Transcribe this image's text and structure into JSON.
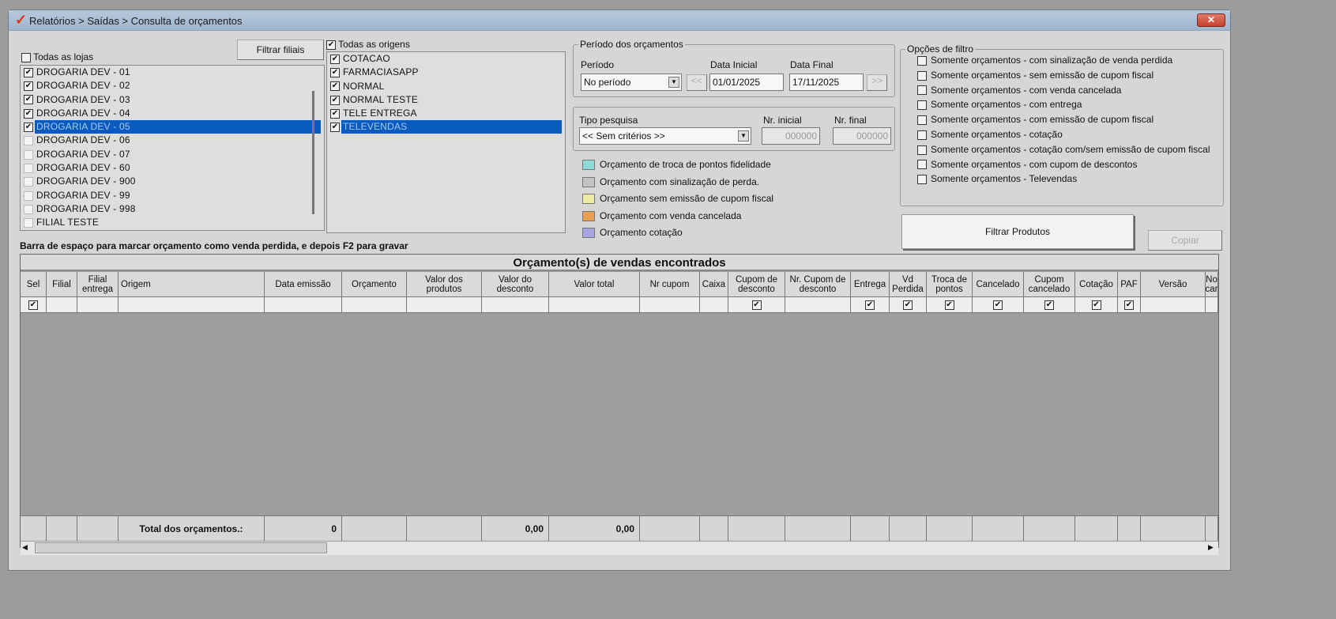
{
  "window": {
    "title": "Relatórios > Saídas > Consulta de orçamentos",
    "close": "✕"
  },
  "lojas": {
    "all_label": "Todas as lojas",
    "all_checked": false,
    "filter_button": "Filtrar filiais",
    "items": [
      {
        "label": "DROGARIA DEV - 01",
        "checked": true
      },
      {
        "label": "DROGARIA DEV - 02",
        "checked": true
      },
      {
        "label": "DROGARIA DEV - 03",
        "checked": true
      },
      {
        "label": "DROGARIA DEV - 04",
        "checked": true
      },
      {
        "label": "DROGARIA DEV - 05",
        "checked": true,
        "selected": true
      },
      {
        "label": "DROGARIA DEV - 06",
        "checked": false
      },
      {
        "label": "DROGARIA DEV - 07",
        "checked": false
      },
      {
        "label": "DROGARIA DEV - 60",
        "checked": false
      },
      {
        "label": "DROGARIA DEV - 900",
        "checked": false
      },
      {
        "label": "DROGARIA DEV - 99",
        "checked": false
      },
      {
        "label": "DROGARIA DEV - 998",
        "checked": false
      },
      {
        "label": "FILIAL TESTE",
        "checked": false
      }
    ]
  },
  "origens": {
    "all_label": "Todas as origens",
    "all_checked": true,
    "items": [
      {
        "label": "COTACAO",
        "checked": true
      },
      {
        "label": "FARMACIASAPP",
        "checked": true
      },
      {
        "label": "NORMAL",
        "checked": true
      },
      {
        "label": "NORMAL TESTE",
        "checked": true
      },
      {
        "label": "TELE ENTREGA",
        "checked": true
      },
      {
        "label": "TELEVENDAS",
        "checked": true,
        "selected": true
      }
    ]
  },
  "periodo": {
    "legend": "Período dos orçamentos",
    "periodo_label": "Período",
    "periodo_value": "No período",
    "data_inicial_label": "Data Inicial",
    "data_inicial": "01/01/2025",
    "data_final_label": "Data Final",
    "data_final": "17/11/2025",
    "prev": "<<",
    "next": ">>"
  },
  "tipo": {
    "label": "Tipo pesquisa",
    "value": "<< Sem critérios >>",
    "nr_inicial_label": "Nr. inicial",
    "nr_inicial": "000000",
    "nr_final_label": "Nr. final",
    "nr_final": "000000"
  },
  "legend_items": [
    {
      "label": "Orçamento de troca de pontos fidelidade",
      "color": "#8fd8d8"
    },
    {
      "label": "Orçamento com sinalização de perda.",
      "color": "#c4c4c4"
    },
    {
      "label": "Orçamento sem emissão de cupom fiscal",
      "color": "#eeeaa0"
    },
    {
      "label": "Orçamento com venda cancelada",
      "color": "#e8a050"
    },
    {
      "label": "Orçamento cotação",
      "color": "#a8a4e4"
    }
  ],
  "opcoes": {
    "legend": "Opções de filtro",
    "items": [
      "Somente orçamentos - com sinalização de venda perdida",
      "Somente orçamentos - sem emissão de cupom fiscal",
      "Somente orçamentos - com venda cancelada",
      "Somente orçamentos - com entrega",
      "Somente orçamentos - com emissão de cupom fiscal",
      "Somente orçamentos - cotação",
      "Somente orçamentos - cotação com/sem emissão de cupom fiscal",
      "Somente orçamentos - com cupom de descontos",
      "Somente orçamentos - Televendas"
    ]
  },
  "buttons": {
    "filtrar_produtos": "Filtrar Produtos",
    "copiar": "Copiar"
  },
  "hint": "Barra de espaço para marcar orçamento como venda perdida, e depois F2 para gravar",
  "grid": {
    "title": "Orçamento(s) de vendas encontrados",
    "columns": [
      {
        "label": "Sel",
        "cb": true
      },
      {
        "label": "Filial"
      },
      {
        "label": "Filial entrega"
      },
      {
        "label": "Origem",
        "align": "left"
      },
      {
        "label": "Data emissão"
      },
      {
        "label": "Orçamento"
      },
      {
        "label": "Valor dos produtos"
      },
      {
        "label": "Valor do desconto"
      },
      {
        "label": "Valor total"
      },
      {
        "label": "Nr cupom"
      },
      {
        "label": "Caixa"
      },
      {
        "label": "Cupom de desconto",
        "cb": true
      },
      {
        "label": "Nr. Cupom de desconto"
      },
      {
        "label": "Entrega",
        "cb": true
      },
      {
        "label": "Vd Perdida",
        "cb": true
      },
      {
        "label": "Troca de pontos",
        "cb": true
      },
      {
        "label": "Cancelado",
        "cb": true
      },
      {
        "label": "Cupom cancelado",
        "cb": true
      },
      {
        "label": "Cotação",
        "cb": true
      },
      {
        "label": "PAF",
        "cb": true
      },
      {
        "label": "Versão"
      },
      {
        "label": "No car"
      }
    ],
    "footer": {
      "label": "Total dos orçamentos.:",
      "count": "0",
      "desconto": "0,00",
      "total": "0,00"
    }
  }
}
